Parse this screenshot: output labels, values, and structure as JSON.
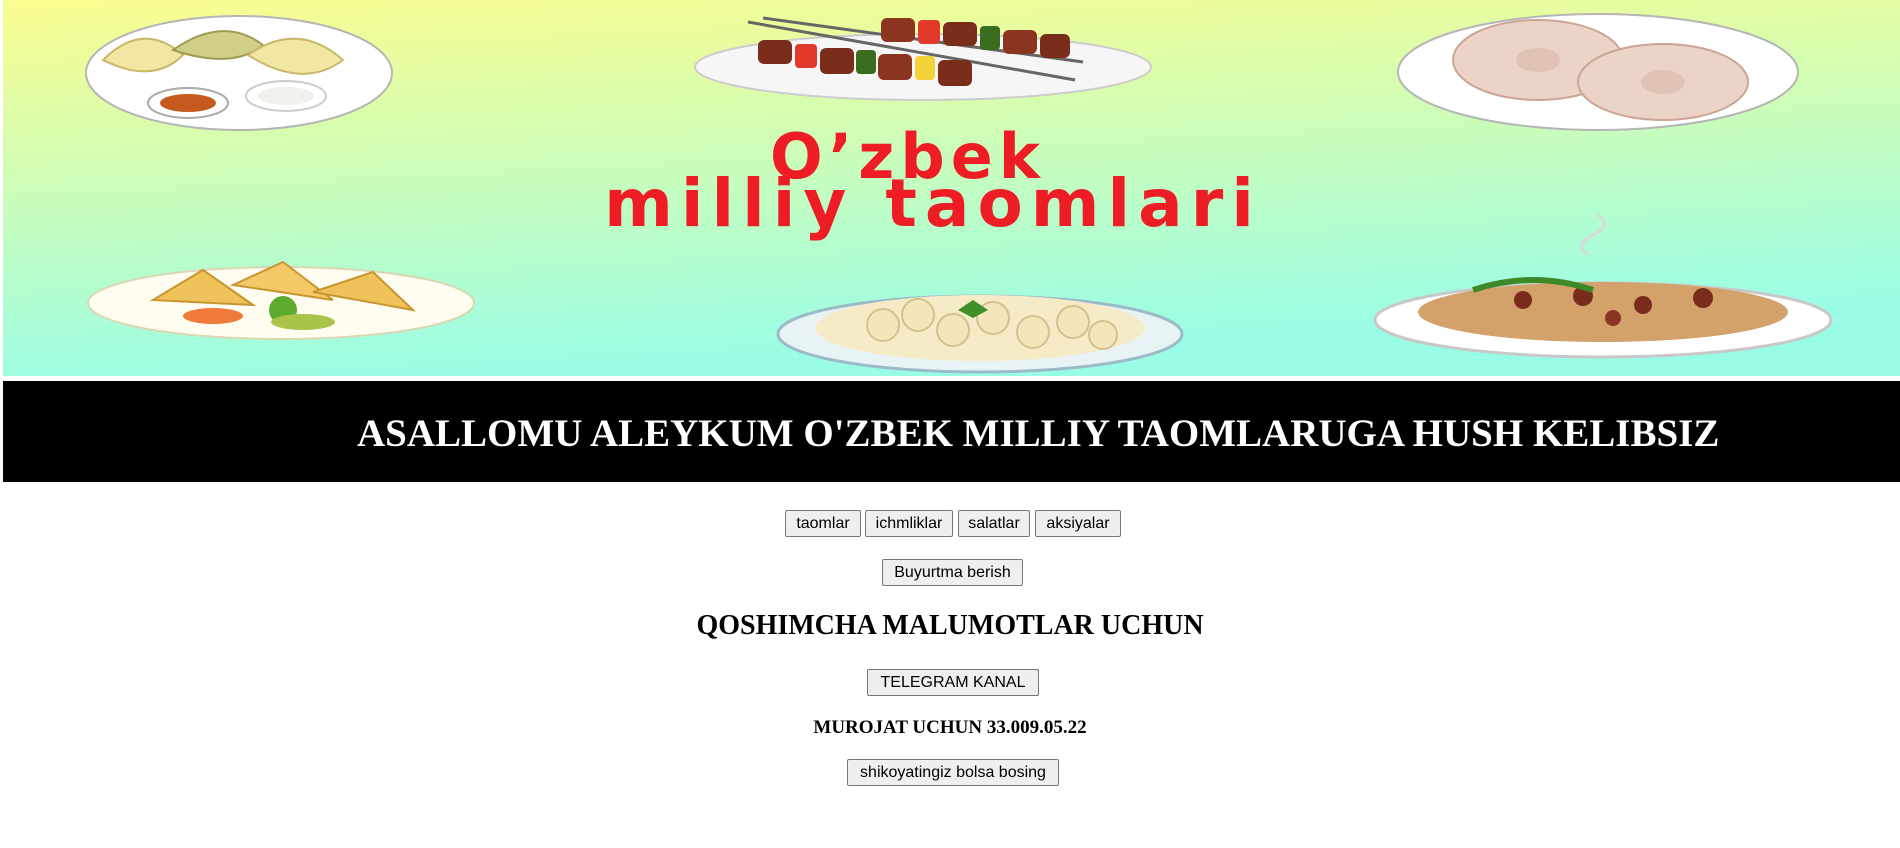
{
  "banner": {
    "title_line1": "O’zbek",
    "title_line2": "milliy taomlari",
    "title_color": "#ee1c25",
    "gradient_top": "#fbfd8f",
    "gradient_bottom": "#99fde6"
  },
  "welcome": {
    "text": "ASALLOMU ALEYKUM O'ZBEK MILLIY TAOMLARUGA HUSH KELIBSIZ"
  },
  "nav": {
    "items": [
      "taomlar",
      "ichmliklar",
      "salatlar",
      "aksiyalar"
    ]
  },
  "order_button": "Buyurtma berish",
  "info_heading": "QOSHIMCHA MALUMOTLAR UCHUN",
  "telegram_button": "TELEGRAM KANAL",
  "contact_text": "MUROJAT UCHUN 33.009.05.22",
  "complaint_button": "shikoyatingiz bolsa bosing"
}
